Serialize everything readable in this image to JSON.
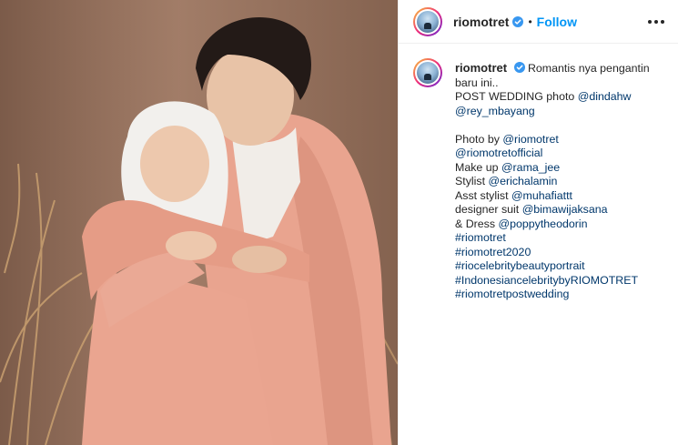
{
  "post": {
    "username": "riomotret",
    "follow_label": "Follow",
    "separator": "•",
    "colors": {
      "accent": "#0095f6",
      "link": "#00376b",
      "verified": "#3897f0"
    }
  },
  "caption": {
    "username": "riomotret",
    "first_text": "Romantis nya pengantin",
    "lines": [
      {
        "text": "baru ini..",
        "type": "text"
      },
      {
        "prefix": "POST WEDDING photo ",
        "mention": "@dindahw"
      },
      {
        "mention": "@rey_mbayang"
      },
      {
        "blank": true
      },
      {
        "prefix": "Photo by ",
        "mention": "@riomotret"
      },
      {
        "mention": "@riomotretofficial"
      },
      {
        "prefix": "Make up ",
        "mention": "@rama_jee"
      },
      {
        "prefix": "Stylist ",
        "mention": "@erichalamin"
      },
      {
        "prefix": "Asst stylist ",
        "mention": "@muhafiattt"
      },
      {
        "prefix": "designer suit ",
        "mention": "@bimawijaksana"
      },
      {
        "prefix": "& Dress ",
        "mention": "@poppytheodorin"
      },
      {
        "mention": "#riomotret"
      },
      {
        "mention": "#riomotret2020"
      },
      {
        "mention": "#riocelebritybeautyportrait"
      },
      {
        "mention": "#IndonesiancelebritybyRIOMOTRET"
      },
      {
        "mention": "#riomotretpostwedding"
      }
    ]
  },
  "icons": [
    "verified-badge-icon",
    "more-options-icon"
  ]
}
